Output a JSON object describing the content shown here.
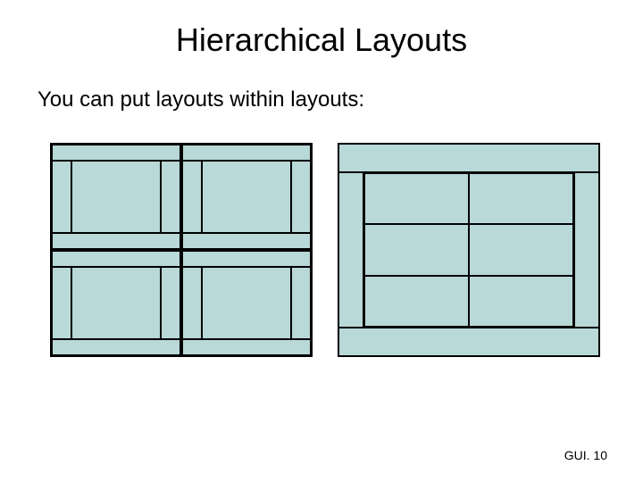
{
  "title": "Hierarchical Layouts",
  "subtitle": "You can put layouts within layouts:",
  "footer": "GUI. 10"
}
